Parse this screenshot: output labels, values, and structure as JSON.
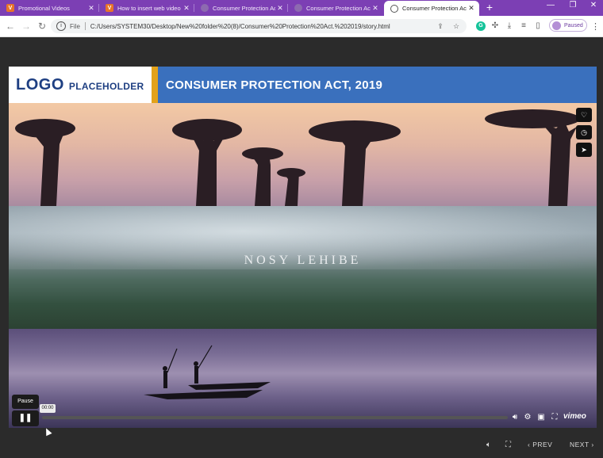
{
  "browser": {
    "tabs": [
      {
        "title": "Promotional Videos",
        "favicon": "vimeo-favicon",
        "active": false
      },
      {
        "title": "How to insert web video",
        "favicon": "vimeo-favicon",
        "active": false
      },
      {
        "title": "Consumer Protection Ac",
        "favicon": "page-favicon",
        "active": false
      },
      {
        "title": "Consumer Protection Ac",
        "favicon": "page-favicon",
        "active": false
      },
      {
        "title": "Consumer Protection Ac",
        "favicon": "globe-favicon",
        "active": true
      }
    ],
    "favicon_letter": "V",
    "new_tab": "+",
    "window_controls": {
      "minimize": "—",
      "restore": "❐",
      "close": "✕"
    },
    "address": {
      "scheme_label": "File",
      "url": "C:/Users/SYSTEM30/Desktop/New%20folder%20(8)/Consumer%20Protection%20Act.%202019/story.html"
    },
    "profile": {
      "status": "Paused"
    },
    "extension_letter": "G",
    "nav": {
      "back": "←",
      "forward": "→",
      "reload": "↻"
    }
  },
  "slide": {
    "logo": {
      "big": "LOGO",
      "small": "PLACEHOLDER"
    },
    "title": "CONSUMER PROTECTION ACT, 2019",
    "colors": {
      "title_bar": "#3a70bd",
      "accent": "#e3a21a",
      "logo_text": "#1e3f82"
    }
  },
  "video": {
    "tagline": "NOSY LEHIBE",
    "pause_tooltip": "Pause",
    "time": "00:00",
    "progress": 0,
    "brand": "vimeo",
    "side_icons": [
      "heart-icon",
      "clock-icon",
      "send-icon"
    ]
  },
  "player_nav": {
    "prev": "PREV",
    "next": "NEXT"
  }
}
